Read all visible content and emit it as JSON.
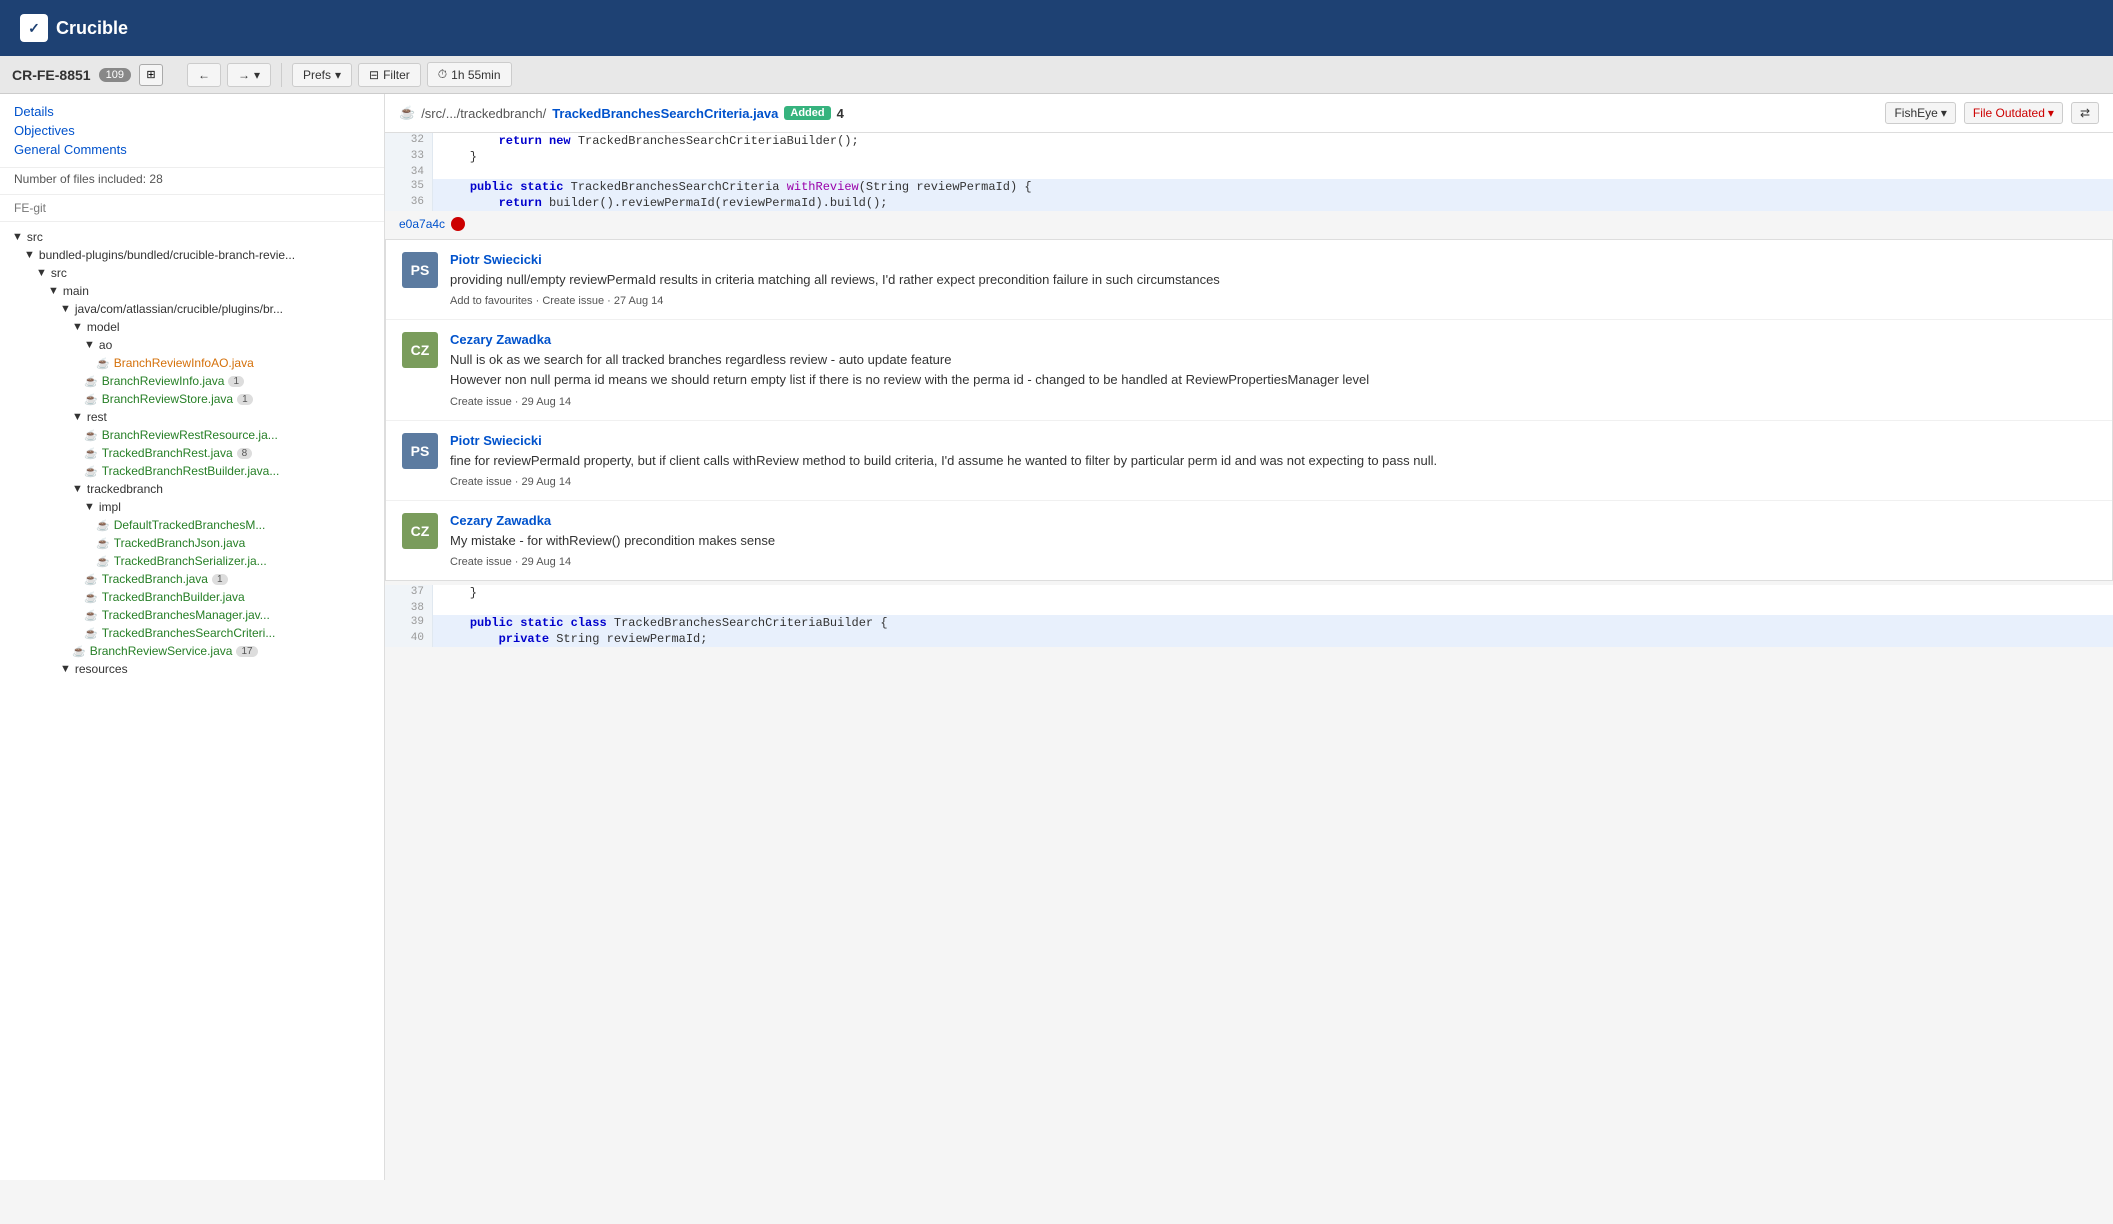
{
  "app": {
    "name": "Crucible",
    "logo_text": "✓"
  },
  "cr_bar": {
    "cr_id": "CR-FE-8851",
    "badge": "109",
    "expand_icon": "⊞"
  },
  "toolbar": {
    "back_icon": "←",
    "forward_icon": "→",
    "dropdown_icon": "▾",
    "prefs_label": "Prefs",
    "filter_icon": "⊟",
    "filter_label": "Filter",
    "clock_icon": "⏱",
    "time_label": "1h 55min"
  },
  "sidebar_nav": {
    "details_label": "Details",
    "objectives_label": "Objectives",
    "general_comments_label": "General Comments",
    "files_info": "Number of files included: 28",
    "repo_label": "FE-git"
  },
  "file_tree": [
    {
      "indent": 1,
      "type": "folder",
      "icon": "▼",
      "label": "src"
    },
    {
      "indent": 2,
      "type": "folder",
      "icon": "▼",
      "label": "bundled-plugins/bundled/crucible-branch-revie..."
    },
    {
      "indent": 3,
      "type": "folder",
      "icon": "▼",
      "label": "src"
    },
    {
      "indent": 4,
      "type": "folder",
      "icon": "▼",
      "label": "main"
    },
    {
      "indent": 5,
      "type": "folder",
      "icon": "▼",
      "label": "java/com/atlassian/crucible/plugins/br..."
    },
    {
      "indent": 6,
      "type": "folder",
      "icon": "▼",
      "label": "model"
    },
    {
      "indent": 7,
      "type": "folder",
      "icon": "▼",
      "label": "ao"
    },
    {
      "indent": 8,
      "type": "file-orange",
      "icon": "☕",
      "label": "BranchReviewInfoAO.java"
    },
    {
      "indent": 7,
      "type": "file-green",
      "icon": "☕",
      "label": "BranchReviewInfo.java",
      "badge": "1"
    },
    {
      "indent": 7,
      "type": "file-green",
      "icon": "☕",
      "label": "BranchReviewStore.java",
      "badge": "1"
    },
    {
      "indent": 6,
      "type": "folder",
      "icon": "▼",
      "label": "rest"
    },
    {
      "indent": 7,
      "type": "file-green",
      "icon": "☕",
      "label": "BranchReviewRestResource.ja..."
    },
    {
      "indent": 7,
      "type": "file-green",
      "icon": "☕",
      "label": "TrackedBranchRest.java",
      "badge": "8"
    },
    {
      "indent": 7,
      "type": "file-green",
      "icon": "☕",
      "label": "TrackedBranchRestBuilder.java..."
    },
    {
      "indent": 6,
      "type": "folder",
      "icon": "▼",
      "label": "trackedbranch"
    },
    {
      "indent": 7,
      "type": "folder",
      "icon": "▼",
      "label": "impl"
    },
    {
      "indent": 8,
      "type": "file-green",
      "icon": "☕",
      "label": "DefaultTrackedBranchesM..."
    },
    {
      "indent": 8,
      "type": "file-green",
      "icon": "☕",
      "label": "TrackedBranchJson.java",
      "badge": ""
    },
    {
      "indent": 8,
      "type": "file-green",
      "icon": "☕",
      "label": "TrackedBranchSerializer.ja..."
    },
    {
      "indent": 7,
      "type": "file-green",
      "icon": "☕",
      "label": "TrackedBranch.java",
      "badge": "1"
    },
    {
      "indent": 7,
      "type": "file-green",
      "icon": "☕",
      "label": "TrackedBranchBuilder.java"
    },
    {
      "indent": 7,
      "type": "file-green",
      "icon": "☕",
      "label": "TrackedBranchesManager.jav..."
    },
    {
      "indent": 7,
      "type": "file-green",
      "icon": "☕",
      "label": "TrackedBranchesSearchCriteri..."
    },
    {
      "indent": 6,
      "type": "file-green",
      "icon": "☕",
      "label": "BranchReviewService.java",
      "badge": "17"
    },
    {
      "indent": 5,
      "type": "folder",
      "icon": "▼",
      "label": "resources"
    }
  ],
  "file_header": {
    "file_icon": "☕",
    "path_prefix": "/src/.../trackedbranch/",
    "file_name": "TrackedBranchesSearchCriteria.java",
    "added_badge": "Added",
    "count": "4",
    "fisheye_label": "FishEye",
    "fisheye_dropdown": "▾",
    "outdated_label": "File Outdated",
    "outdated_dropdown": "▾",
    "sync_icon": "⇄"
  },
  "commit_sha": {
    "sha": "e0a7a4c"
  },
  "code_lines": [
    {
      "num": 32,
      "code": "        return new TrackedBranchesSearchCriteriaBuilder();",
      "style": "normal"
    },
    {
      "num": 33,
      "code": "    }",
      "style": "normal"
    },
    {
      "num": 34,
      "code": "",
      "style": "normal"
    },
    {
      "num": 35,
      "code": "    public static TrackedBranchesSearchCriteria withReview(String reviewPermaId) {",
      "style": "highlight"
    },
    {
      "num": 36,
      "code": "        return builder().reviewPermaId(reviewPermaId).build();",
      "style": "highlight"
    }
  ],
  "code_lines_bottom": [
    {
      "num": 37,
      "code": "    }",
      "style": "normal"
    },
    {
      "num": 38,
      "code": "",
      "style": "normal"
    },
    {
      "num": 39,
      "code": "    public static class TrackedBranchesSearchCriteriaBuilder {",
      "style": "highlight"
    },
    {
      "num": 40,
      "code": "        private String reviewPermaId;",
      "style": "highlight"
    }
  ],
  "comments": [
    {
      "author": "Piotr Swiecicki",
      "avatar_initials": "PS",
      "avatar_class": "avatar-piotr",
      "text": "providing null/empty reviewPermaId results in criteria matching all reviews, I'd rather expect precondition failure in such circumstances",
      "actions": "Add to favourites · Create issue · 27 Aug 14"
    },
    {
      "author": "Cezary Zawadka",
      "avatar_initials": "CZ",
      "avatar_class": "avatar-cezary",
      "text": "Null is ok as we search for all tracked branches regardless review - auto update feature\nHowever non null perma id means we should return empty list if there is no review with the perma id - changed to be handled at ReviewPropertiesManager level",
      "actions": "Create issue · 29 Aug 14"
    },
    {
      "author": "Piotr Swiecicki",
      "avatar_initials": "PS",
      "avatar_class": "avatar-piotr",
      "text": "fine for reviewPermaId property, but if client calls withReview method to build criteria, I'd assume he wanted to filter by particular perm id and was not expecting to pass null.",
      "actions": "Create issue · 29 Aug 14"
    },
    {
      "author": "Cezary Zawadka",
      "avatar_initials": "CZ",
      "avatar_class": "avatar-cezary",
      "text": "My mistake - for withReview() precondition makes sense",
      "actions": "Create issue · 29 Aug 14"
    }
  ]
}
